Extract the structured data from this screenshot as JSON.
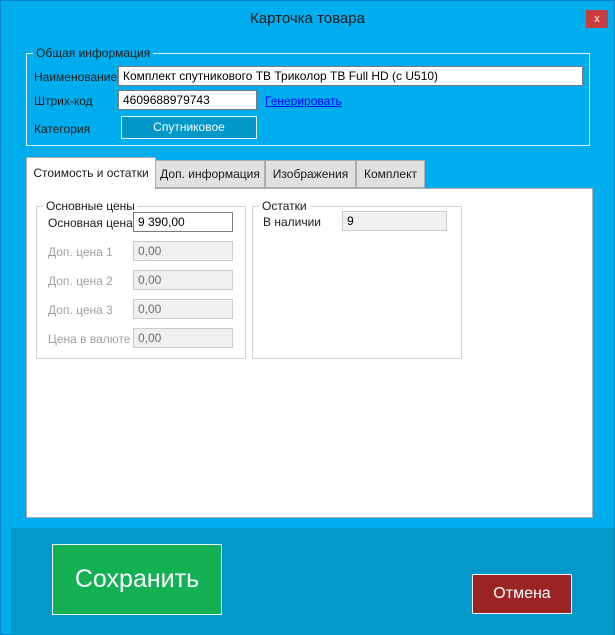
{
  "window": {
    "title": "Карточка товара",
    "close_label": "x"
  },
  "general": {
    "legend": "Общая информация",
    "name_label": "Наименование",
    "name_value": "Комплект спутникового ТВ Триколор ТВ Full HD (с U510)",
    "barcode_label": "Штрих-код",
    "barcode_value": "4609688979743",
    "generate_link": "Генерировать",
    "category_label": "Категория",
    "category_value": "Спутниковое"
  },
  "tabs": [
    {
      "label": "Стоимость и остатки",
      "active": true
    },
    {
      "label": "Доп. информация",
      "active": false
    },
    {
      "label": "Изображения",
      "active": false
    },
    {
      "label": "Комплект",
      "active": false
    }
  ],
  "prices": {
    "legend": "Основные цены",
    "rows": [
      {
        "label": "Основная цена",
        "value": "9 390,00",
        "enabled": true
      },
      {
        "label": "Доп. цена 1",
        "value": "0,00",
        "enabled": false
      },
      {
        "label": "Доп. цена 2",
        "value": "0,00",
        "enabled": false
      },
      {
        "label": "Доп. цена 3",
        "value": "0,00",
        "enabled": false
      },
      {
        "label": "Цена в валюте",
        "value": "0,00",
        "enabled": false
      }
    ]
  },
  "stock": {
    "legend": "Остатки",
    "in_stock_label": "В наличии",
    "in_stock_value": "9"
  },
  "footer": {
    "save_label": "Сохранить",
    "cancel_label": "Отмена"
  },
  "colors": {
    "window_bg": "#00aeef",
    "footer_bg": "#0199c9",
    "save_bg": "#13b153",
    "cancel_bg": "#9b2323",
    "category_bg": "#0097c9"
  }
}
